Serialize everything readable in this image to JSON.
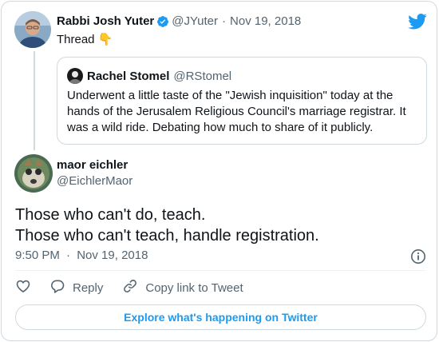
{
  "colors": {
    "accent": "#1d9bf0",
    "muted": "#536471",
    "border": "#cfd9de"
  },
  "thread_tweet": {
    "author_name": "Rabbi Josh Yuter",
    "handle": "@JYuter",
    "separator": "·",
    "date": "Nov 19, 2018",
    "text": "Thread 👇",
    "verified": true
  },
  "quoted_tweet": {
    "author_name": "Rachel Stomel",
    "handle": "@RStomel",
    "text": "Underwent a little taste of the \"Jewish inquisition\" today at the hands of the Jerusalem Religious Council's marriage registrar. It was a wild ride. Debating how much to share of it publicly."
  },
  "main_tweet": {
    "author_name": "maor eichler",
    "handle": "@EichlerMaor",
    "line1": "Those who can't do, teach.",
    "line2": "Those who can't teach, handle registration.",
    "time": "9:50 PM",
    "separator": "·",
    "date": "Nov 19, 2018"
  },
  "actions": {
    "reply_label": "Reply",
    "copy_link_label": "Copy link to Tweet"
  },
  "explore_label": "Explore what's happening on Twitter",
  "icons": [
    "verified-badge-icon",
    "twitter-bird-icon",
    "info-icon",
    "heart-icon",
    "reply-icon",
    "link-icon"
  ]
}
